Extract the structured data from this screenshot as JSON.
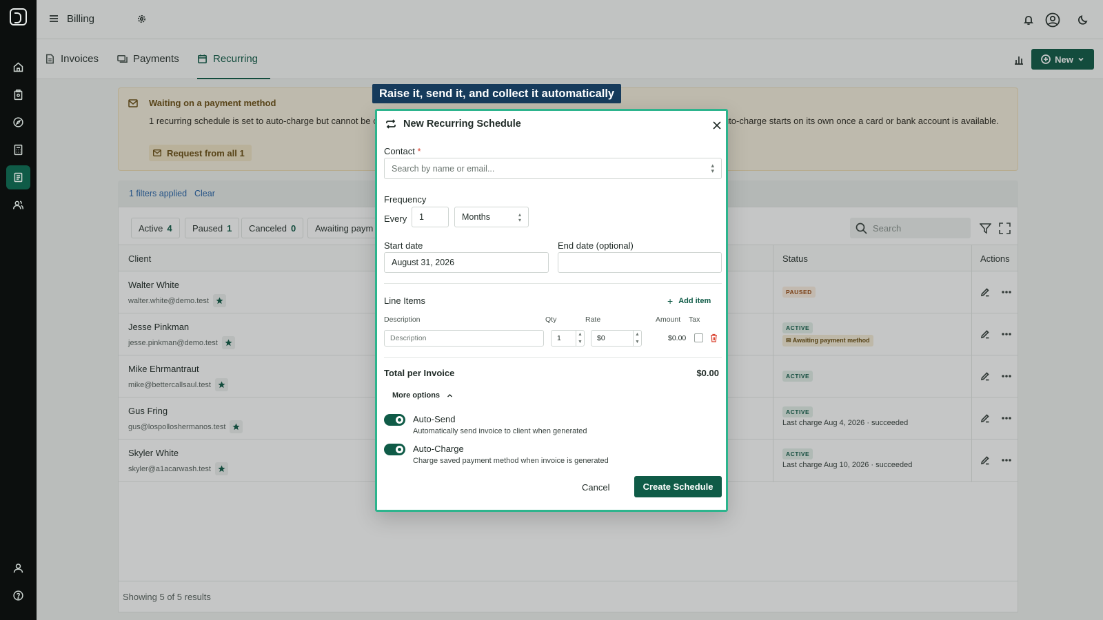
{
  "topbar": {
    "title": "Billing"
  },
  "tabs": [
    {
      "label": "Invoices"
    },
    {
      "label": "Payments"
    },
    {
      "label": "Recurring"
    }
  ],
  "new_button": {
    "label": "New"
  },
  "banner": {
    "title": "Waiting on a payment method",
    "text": "1 recurring schedule is set to auto-charge but cannot be charged yet because the client has no payment method on file. Invoices stay open and auto-charge starts on its own once a card or bank account is available.",
    "request_label": "Request from all 1"
  },
  "filters": {
    "applied": "1 filters applied",
    "clear": "Clear"
  },
  "chips": [
    {
      "label": "Active",
      "count": "4"
    },
    {
      "label": "Paused",
      "count": "1"
    },
    {
      "label": "Canceled",
      "count": "0"
    },
    {
      "label": "Awaiting paym",
      "count": ""
    }
  ],
  "search": {
    "placeholder": "Search"
  },
  "table": {
    "columns": {
      "client": "Client",
      "status": "Status",
      "actions": "Actions"
    },
    "rows": [
      {
        "name": "Walter White",
        "email": "walter.white@demo.test",
        "status": "PAUSED",
        "note": "",
        "last": ""
      },
      {
        "name": "Jesse Pinkman",
        "email": "jesse.pinkman@demo.test",
        "status": "ACTIVE",
        "note": "Awaiting payment method",
        "last": ""
      },
      {
        "name": "Mike Ehrmantraut",
        "email": "mike@bettercallsaul.test",
        "status": "ACTIVE",
        "note": "",
        "last": ""
      },
      {
        "name": "Gus Fring",
        "email": "gus@lospolloshermanos.test",
        "status": "ACTIVE",
        "note": "",
        "last": "Last charge Aug 4, 2026 · succeeded"
      },
      {
        "name": "Skyler White",
        "email": "skyler@a1acarwash.test",
        "status": "ACTIVE",
        "note": "",
        "last": "Last charge Aug 10, 2026 · succeeded"
      }
    ],
    "footer": "Showing 5 of 5 results"
  },
  "hint": "Raise it, send it, and collect it automatically",
  "modal": {
    "title": "New Recurring Schedule",
    "contact_label": "Contact",
    "contact_required": "*",
    "contact_placeholder": "Search by name or email...",
    "frequency_label": "Frequency",
    "every_label": "Every",
    "every_value": "1",
    "period_value": "Months",
    "start_label": "Start date",
    "start_value": "August 31, 2026",
    "end_label": "End date (optional)",
    "end_value": "",
    "line_items_label": "Line Items",
    "add_item_label": "Add item",
    "cols": {
      "description": "Description",
      "qty": "Qty",
      "rate": "Rate",
      "amount": "Amount",
      "tax": "Tax"
    },
    "item": {
      "description_placeholder": "Description",
      "qty": "1",
      "rate": "$0",
      "amount": "$0.00"
    },
    "total_label": "Total per Invoice",
    "total_value": "$0.00",
    "more_options": "More options",
    "auto_send": {
      "title": "Auto-Send",
      "desc": "Automatically send invoice to client when generated",
      "on": true
    },
    "auto_charge": {
      "title": "Auto-Charge",
      "desc": "Charge saved payment method when invoice is generated",
      "on": true
    },
    "cancel_label": "Cancel",
    "create_label": "Create Schedule"
  },
  "colors": {
    "brand": "#0f5b47",
    "modal_border": "#2db48d",
    "hint_bg": "#163b5c"
  }
}
